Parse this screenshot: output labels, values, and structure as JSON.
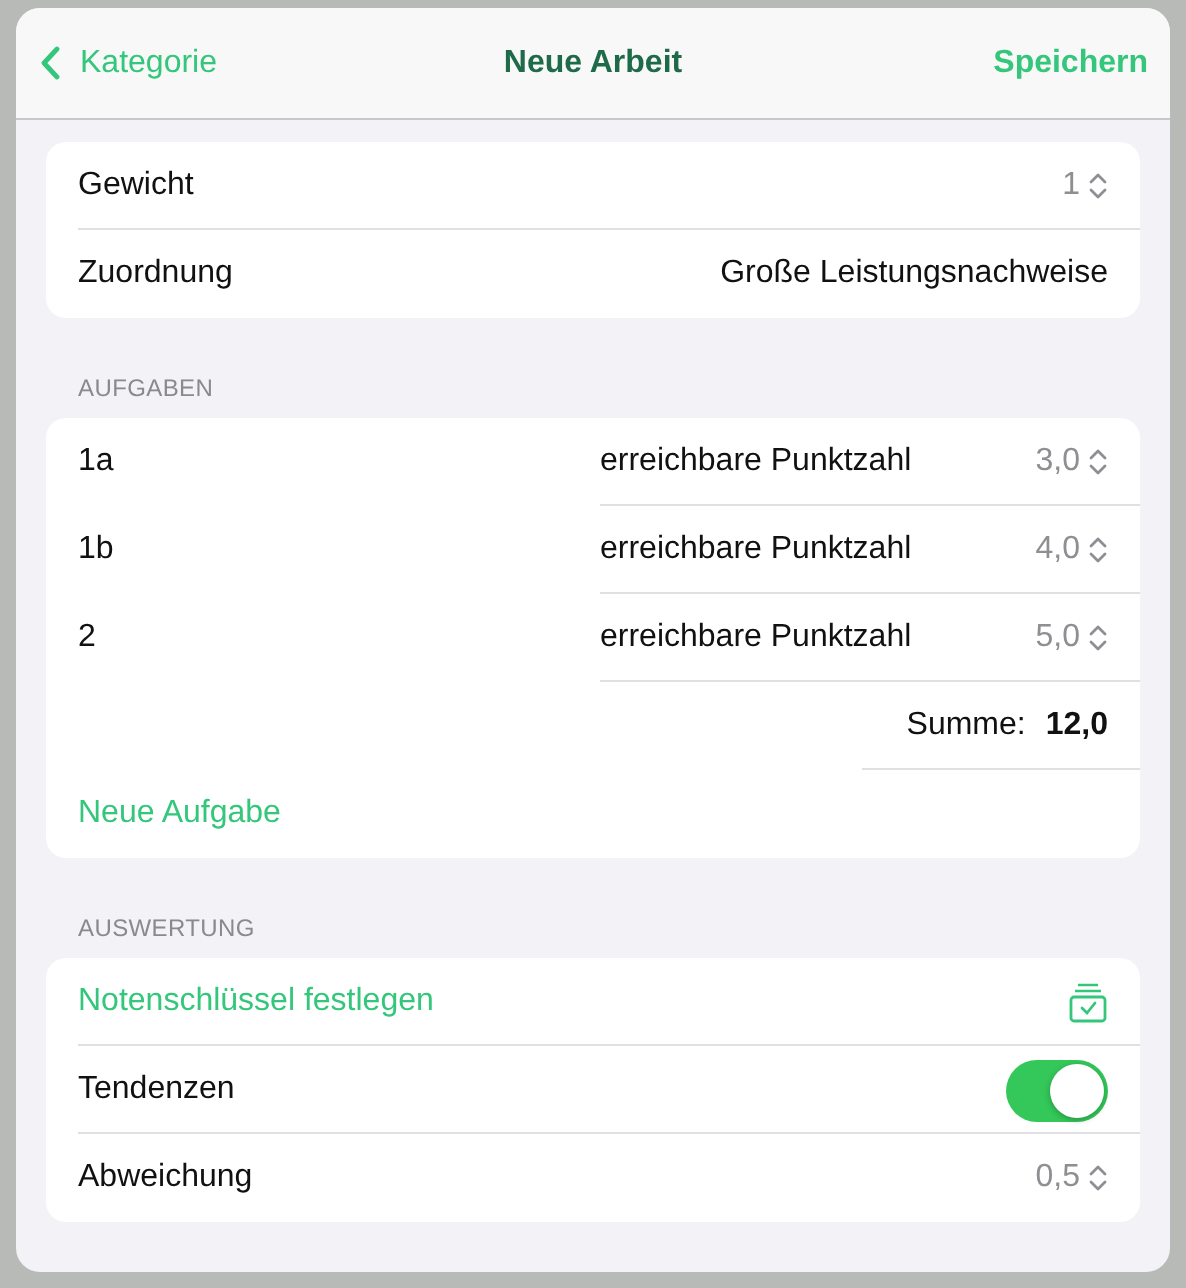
{
  "nav": {
    "back": "Kategorie",
    "title": "Neue Arbeit",
    "action": "Speichern"
  },
  "settings": [
    {
      "kind": "stepper",
      "label": "Gewicht",
      "value": "1"
    },
    {
      "kind": "value",
      "label": "Zuordnung",
      "value": "Große Leistungsnachweise"
    }
  ],
  "tasks": {
    "header": "AUFGABEN",
    "items": [
      {
        "name": "1a",
        "field": "erreichbare Punktzahl",
        "value": "3,0"
      },
      {
        "name": "1b",
        "field": "erreichbare Punktzahl",
        "value": "4,0"
      },
      {
        "name": "2",
        "field": "erreichbare Punktzahl",
        "value": "5,0"
      }
    ],
    "sum_label": "Summe:",
    "sum": "12,0",
    "add": "Neue Aufgabe"
  },
  "evaluation": {
    "header": "AUSWERTUNG",
    "rows": [
      {
        "kind": "link",
        "label": "Notenschlüssel festlegen"
      },
      {
        "kind": "toggle",
        "label": "Tendenzen",
        "on": true
      },
      {
        "kind": "stepper",
        "label": "Abweichung",
        "value": "0,5"
      }
    ]
  }
}
